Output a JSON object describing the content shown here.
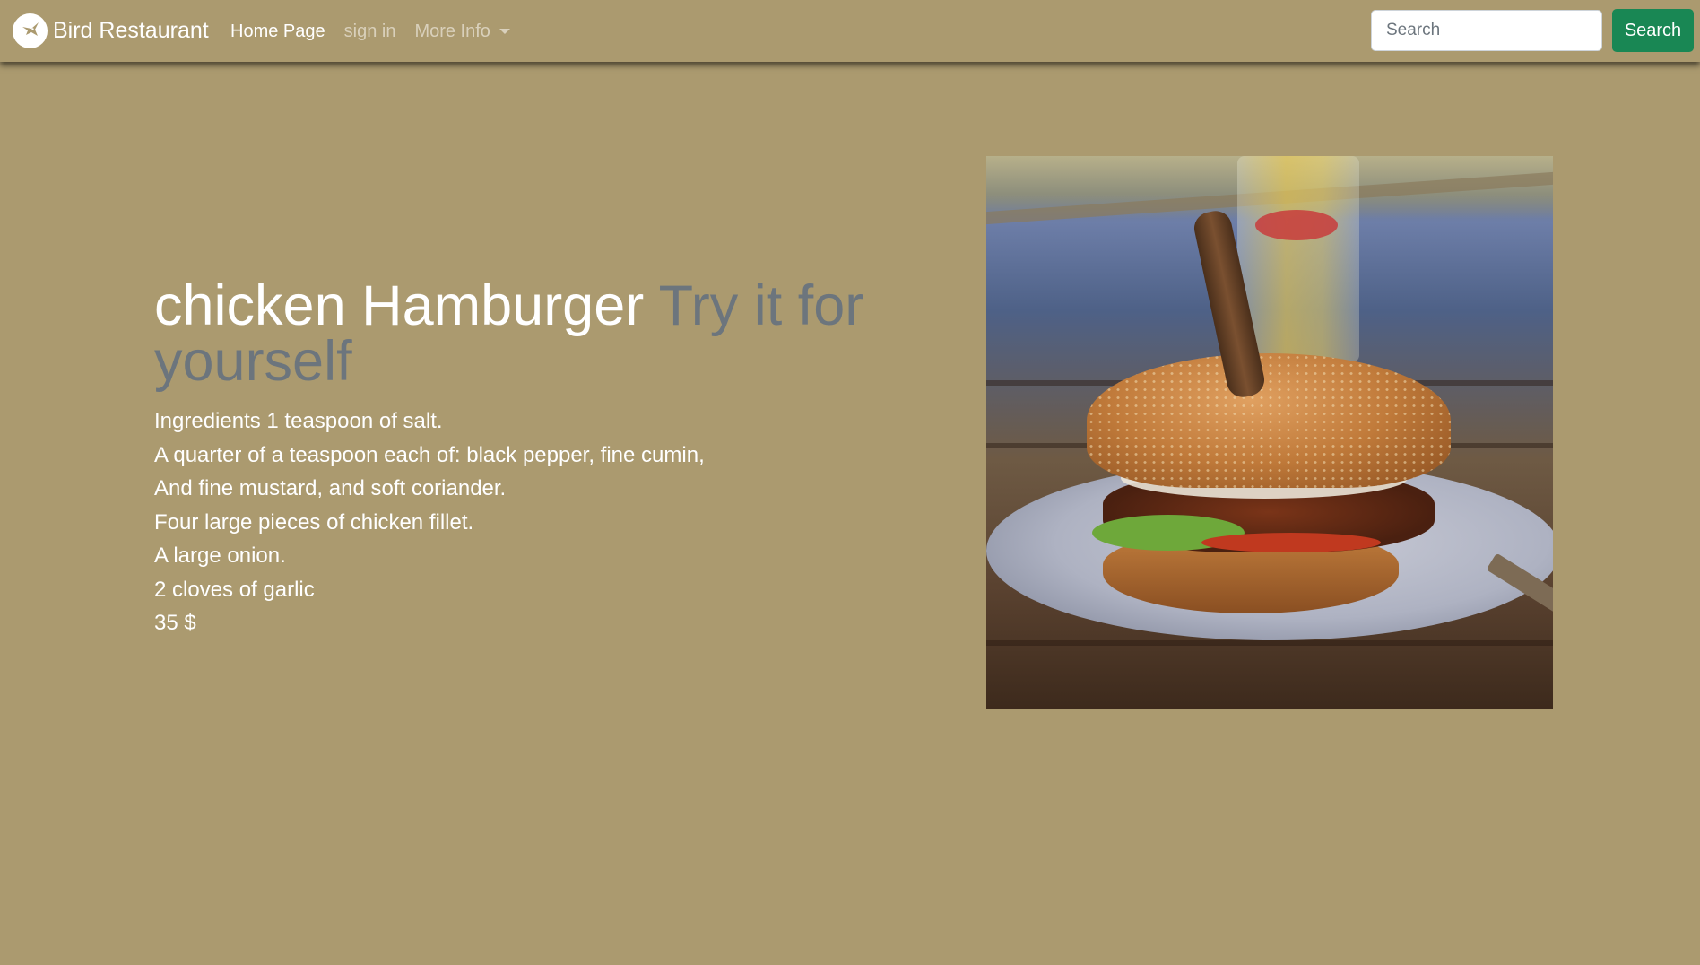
{
  "navbar": {
    "brand": {
      "name": "Bird Restaurant",
      "logo_icon": "bird-icon"
    },
    "links": [
      {
        "label": "Home Page",
        "active": true
      },
      {
        "label": "sign in",
        "active": false
      },
      {
        "label": "More Info",
        "active": false,
        "dropdown": true
      }
    ],
    "search": {
      "placeholder": "Search",
      "value": "",
      "button_label": "Search"
    }
  },
  "dish": {
    "title": "chicken Hamburger",
    "tagline": "Try it for yourself",
    "ingredients": [
      "Ingredients 1 teaspoon of salt.",
      "A quarter of a teaspoon each of: black pepper, fine cumin,",
      "And fine mustard, and soft coriander.",
      "Four large pieces of chicken fillet.",
      "A large onion.",
      "2 cloves of garlic"
    ],
    "price": "35 $",
    "image_icon": "hamburger-photo"
  },
  "colors": {
    "page_background": "#ab9a6f",
    "search_button": "#198754",
    "tagline": "#6c757d",
    "text": "#ffffff"
  }
}
